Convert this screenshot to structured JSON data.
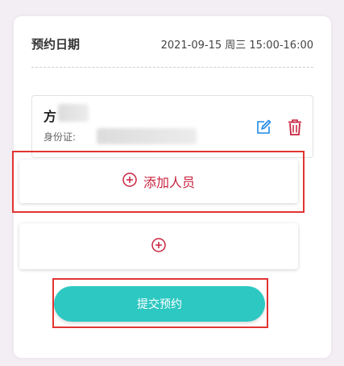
{
  "booking": {
    "date_label": "预约日期",
    "date_value": "2021-09-15 周三 15:00-16:00"
  },
  "person": {
    "name_visible": "方",
    "id_label": "身份证:"
  },
  "actions": {
    "add_person_label": "添加人员",
    "submit_label": "提交预约"
  },
  "colors": {
    "accent_red": "#c8233f",
    "edit_blue": "#1e88e5",
    "submit_teal": "#2ec8c2",
    "highlight_box": "#e23434"
  },
  "icons": {
    "edit": "edit-icon",
    "delete": "trash-icon",
    "add": "plus-circle-icon"
  }
}
